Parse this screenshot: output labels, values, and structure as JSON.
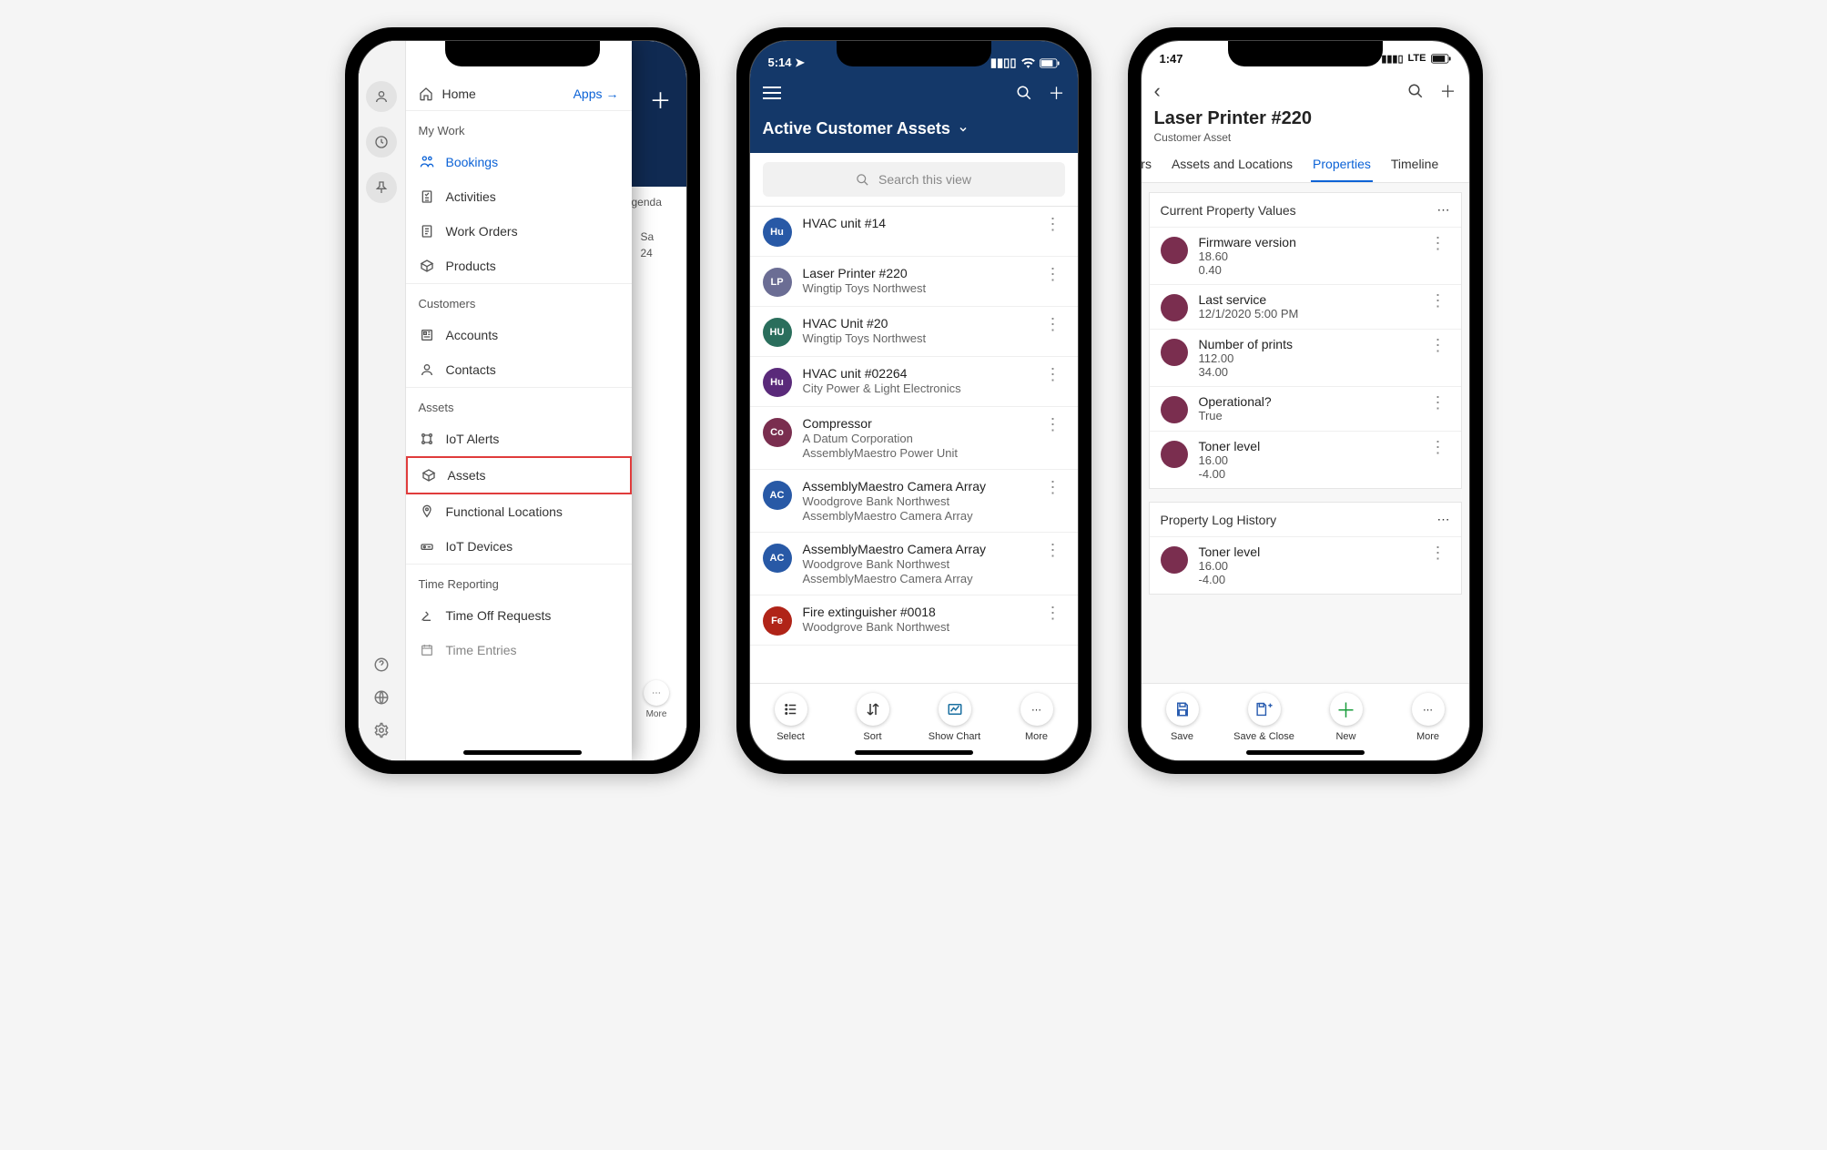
{
  "phone1": {
    "underlay": {
      "agenda_label": "genda",
      "day_label": "Sa",
      "day_num": "24",
      "more_label": "More"
    },
    "nav_top": {
      "home_label": "Home",
      "apps_label": "Apps"
    },
    "sections": {
      "mywork": {
        "header": "My Work",
        "items": [
          "Bookings",
          "Activities",
          "Work Orders",
          "Products"
        ]
      },
      "customers": {
        "header": "Customers",
        "items": [
          "Accounts",
          "Contacts"
        ]
      },
      "assets": {
        "header": "Assets",
        "items": [
          "IoT Alerts",
          "Assets",
          "Functional Locations",
          "IoT Devices"
        ]
      },
      "timereporting": {
        "header": "Time Reporting",
        "items": [
          "Time Off Requests",
          "Time Entries"
        ]
      }
    }
  },
  "phone2": {
    "status_time": "5:14",
    "header_title": "Active Customer Assets",
    "search_placeholder": "Search this view",
    "list": [
      {
        "initials": "Hu",
        "color": "#2859a6",
        "title": "HVAC unit #14",
        "sub1": "",
        "sub2": ""
      },
      {
        "initials": "LP",
        "color": "#6b6d94",
        "title": "Laser Printer #220",
        "sub1": "Wingtip Toys Northwest",
        "sub2": ""
      },
      {
        "initials": "HU",
        "color": "#2a6e5c",
        "title": "HVAC Unit #20",
        "sub1": "Wingtip Toys Northwest",
        "sub2": ""
      },
      {
        "initials": "Hu",
        "color": "#5a2a7a",
        "title": "HVAC unit #02264",
        "sub1": "City Power & Light Electronics",
        "sub2": ""
      },
      {
        "initials": "Co",
        "color": "#7a2e4f",
        "title": "Compressor",
        "sub1": "A Datum Corporation",
        "sub2": "AssemblyMaestro Power Unit"
      },
      {
        "initials": "AC",
        "color": "#2859a6",
        "title": "AssemblyMaestro Camera Array",
        "sub1": "Woodgrove Bank Northwest",
        "sub2": "AssemblyMaestro Camera Array"
      },
      {
        "initials": "AC",
        "color": "#2859a6",
        "title": "AssemblyMaestro Camera Array",
        "sub1": "Woodgrove Bank Northwest",
        "sub2": "AssemblyMaestro Camera Array"
      },
      {
        "initials": "Fe",
        "color": "#b02418",
        "title": "Fire extinguisher #0018",
        "sub1": "Woodgrove Bank Northwest",
        "sub2": ""
      }
    ],
    "bottom": [
      "Select",
      "Sort",
      "Show Chart",
      "More"
    ]
  },
  "phone3": {
    "status_time": "1:47",
    "status_network": "LTE",
    "title": "Laser Printer #220",
    "subtitle": "Customer Asset",
    "tabs": {
      "partial_left": "ers",
      "t1": "Assets and Locations",
      "t2": "Properties",
      "t3": "Timeline"
    },
    "section_current": "Current Property Values",
    "section_history": "Property Log History",
    "props": [
      {
        "name": "Firmware version",
        "value": "18.60",
        "delta": "0.40"
      },
      {
        "name": "Last service",
        "value": "12/1/2020 5:00 PM",
        "delta": ""
      },
      {
        "name": "Number of prints",
        "value": "112.00",
        "delta": "34.00"
      },
      {
        "name": "Operational?",
        "value": "True",
        "delta": ""
      },
      {
        "name": "Toner level",
        "value": "16.00",
        "delta": "-4.00"
      }
    ],
    "history": [
      {
        "name": "Toner level",
        "value": "16.00",
        "delta": "-4.00"
      }
    ],
    "bottom": [
      "Save",
      "Save & Close",
      "New",
      "More"
    ]
  }
}
